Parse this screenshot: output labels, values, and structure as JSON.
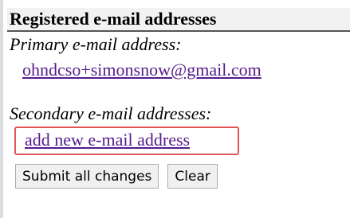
{
  "section": {
    "heading": "Registered e-mail addresses",
    "primary_label": "Primary e-mail address:",
    "primary_email": "ohndcso+simonsnow@gmail.com",
    "secondary_label": "Secondary e-mail addresses:",
    "add_link": "add new e-mail address"
  },
  "buttons": {
    "submit": "Submit all changes",
    "clear": "Clear"
  },
  "colors": {
    "link": "#551a8b",
    "highlight_border": "#e05555"
  }
}
